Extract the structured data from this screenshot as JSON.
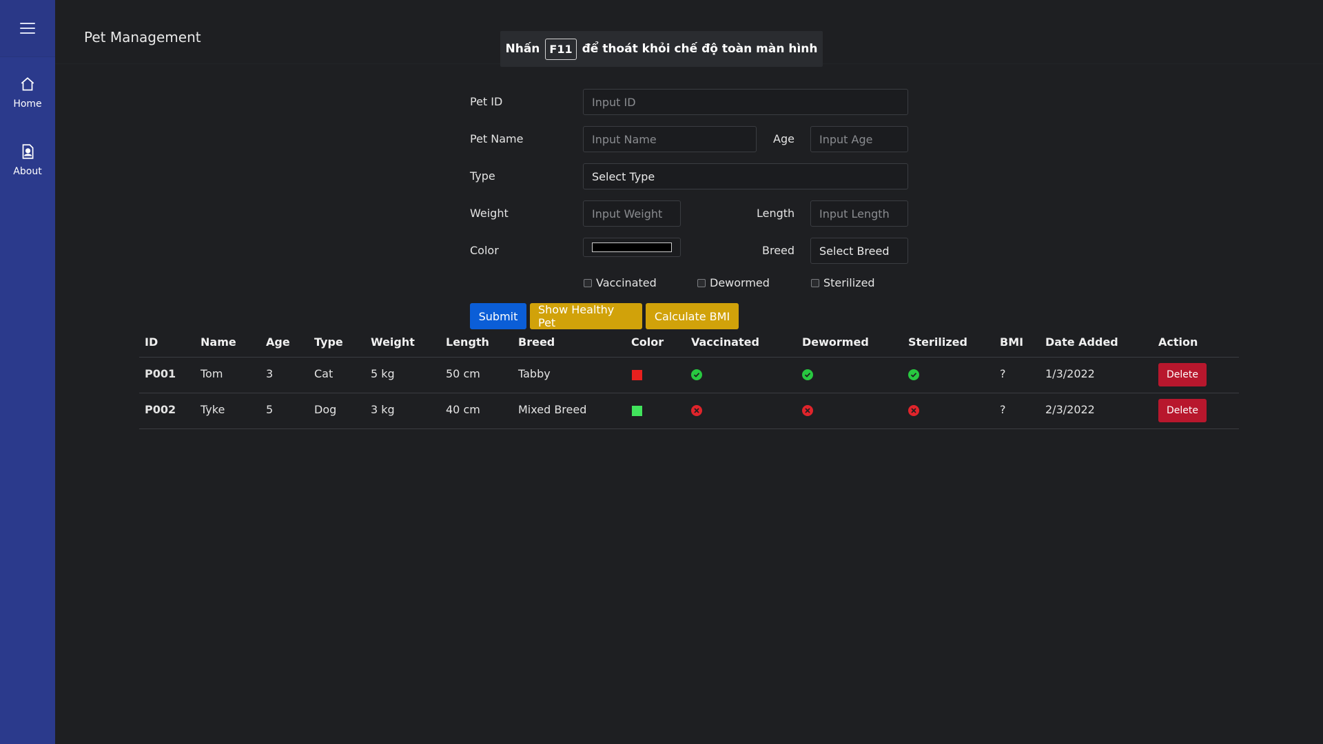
{
  "app": {
    "title": "Pet Management"
  },
  "toast": {
    "prefix": "Nhấn",
    "key": "F11",
    "suffix": "để thoát khỏi chế độ toàn màn hình"
  },
  "sidebar": {
    "items": [
      {
        "label": "Home",
        "icon": "home-icon"
      },
      {
        "label": "About",
        "icon": "contact-card-icon"
      }
    ]
  },
  "form": {
    "pet_id": {
      "label": "Pet ID",
      "placeholder": "Input ID"
    },
    "pet_name": {
      "label": "Pet Name",
      "placeholder": "Input Name"
    },
    "age": {
      "label": "Age",
      "placeholder": "Input Age"
    },
    "type": {
      "label": "Type",
      "value": "Select Type"
    },
    "weight": {
      "label": "Weight",
      "placeholder": "Input Weight"
    },
    "length": {
      "label": "Length",
      "placeholder": "Input Length"
    },
    "color": {
      "label": "Color",
      "value": "#000000"
    },
    "breed": {
      "label": "Breed",
      "value": "Select Breed"
    },
    "checks": {
      "vaccinated": "Vaccinated",
      "dewormed": "Dewormed",
      "sterilized": "Sterilized"
    },
    "buttons": {
      "submit": "Submit",
      "show_healthy": "Show Healthy Pet",
      "calc_bmi": "Calculate BMI"
    }
  },
  "table": {
    "headers": [
      "ID",
      "Name",
      "Age",
      "Type",
      "Weight",
      "Length",
      "Breed",
      "Color",
      "Vaccinated",
      "Dewormed",
      "Sterilized",
      "BMI",
      "Date Added",
      "Action"
    ],
    "rows": [
      {
        "id": "P001",
        "name": "Tom",
        "age": "3",
        "type": "Cat",
        "weight": "5 kg",
        "length": "50 cm",
        "breed": "Tabby",
        "color": "#e8201e",
        "vaccinated": "yes",
        "dewormed": "yes",
        "sterilized": "yes",
        "bmi": "?",
        "date": "1/3/2022",
        "action": "Delete"
      },
      {
        "id": "P002",
        "name": "Tyke",
        "age": "5",
        "type": "Dog",
        "weight": "3 kg",
        "length": "40 cm",
        "breed": "Mixed Breed",
        "color": "#41e35c",
        "vaccinated": "no",
        "dewormed": "no",
        "sterilized": "no",
        "bmi": "?",
        "date": "2/3/2022",
        "action": "Delete"
      }
    ]
  },
  "colors": {
    "sidebar": "#2b3a8c",
    "primary": "#0b5ed7",
    "warning": "#d1a20a",
    "danger": "#b8172d",
    "success": "#28c840",
    "error": "#e0242b"
  }
}
